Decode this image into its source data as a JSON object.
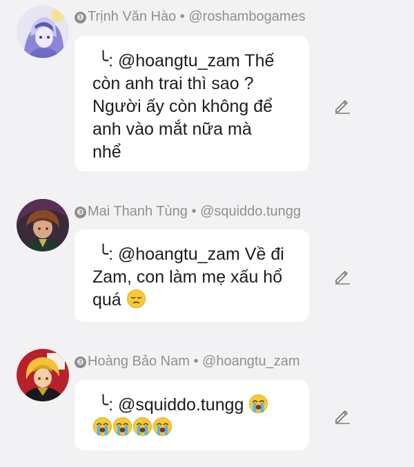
{
  "comments": [
    {
      "rank": "❶",
      "author": "Trịnh Văn Hào",
      "separator": "•",
      "handle": "@roshambogames",
      "reply_mark": "╰",
      "mention": ": @hoangtu_zam",
      "text_lines": [
        "Thế",
        "còn anh trai thì sao ?",
        "Người ấy còn không để",
        "anh vào mắt nữa mà",
        "nhể"
      ],
      "avatar_icon": "anime-avatar-lavender"
    },
    {
      "rank": "❸",
      "author": "Mai Thanh Tùng",
      "separator": "•",
      "handle": "@squiddo.tungg",
      "reply_mark": "╰",
      "mention": ": @hoangtu_zam",
      "text_lines": [
        "Về đi",
        "Zam, con làm mẹ xấu hổ",
        "quá"
      ],
      "emoji_icon": "pensive-face-emoji",
      "avatar_icon": "anime-avatar-dark"
    },
    {
      "rank": "❷",
      "author": "Hoàng Bảo Nam",
      "separator": "•",
      "handle": "@hoangtu_zam",
      "reply_mark": "╰",
      "mention": ": @squiddo.tungg",
      "emoji_icon": "loudly-crying-face-emoji",
      "avatar_icon": "anime-avatar-red-gold"
    }
  ],
  "colors": {
    "background": "#f2f2f4",
    "bubble": "#ffffff",
    "meta_text": "#8f8f8f",
    "body_text": "#1c1c1c"
  },
  "edit_icon": "pencil-icon"
}
